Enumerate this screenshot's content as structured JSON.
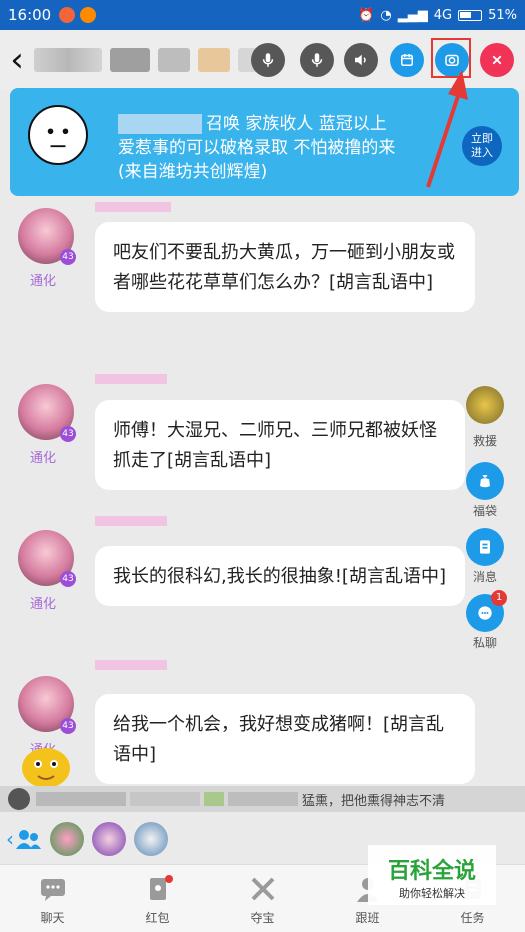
{
  "status_bar": {
    "time": "16:00",
    "network": "4G",
    "battery": "51%"
  },
  "header": {
    "actions": [
      "mic-icon",
      "mic-icon",
      "speaker-icon",
      "calendar-icon",
      "camera-icon",
      "close-icon"
    ]
  },
  "banner": {
    "line1": "召唤 家族收人  蓝冠以上",
    "line2": "爱惹事的可以破格录取  不怕被撸的来",
    "line3": "(来自潍坊共创辉煌)",
    "enter_line1": "立即",
    "enter_line2": "进入"
  },
  "messages": [
    {
      "place": "通化",
      "level": "43",
      "text": "吧友们不要乱扔大黄瓜，万一砸到小朋友或者哪些花花草草们怎么办？[胡言乱语中]"
    },
    {
      "place": "通化",
      "level": "43",
      "text": "师傅！大湿兄、二师兄、三师兄都被妖怪抓走了[胡言乱语中]"
    },
    {
      "place": "通化",
      "level": "43",
      "text": "我长的很科幻,我长的很抽象![胡言乱语中]"
    },
    {
      "place": "通化",
      "level": "43",
      "text": "给我一个机会，我好想变成猪啊！[胡言乱语中]"
    }
  ],
  "side_actions": [
    {
      "label": "救援",
      "icon": "avatar-icon"
    },
    {
      "label": "福袋",
      "icon": "lucky-bag-icon"
    },
    {
      "label": "消息",
      "icon": "message-icon"
    },
    {
      "label": "私聊",
      "icon": "private-chat-icon",
      "badge": "1"
    }
  ],
  "notice": {
    "text": "猛熏，把他熏得神志不清"
  },
  "tabs": [
    "聊天",
    "红包",
    "夺宝",
    "跟班",
    "任务"
  ],
  "watermark": {
    "title": "百科全说",
    "subtitle": "助你轻松解决"
  },
  "colors": {
    "status_bar": "#1565c0",
    "banner": "#39b3ec",
    "accent_red": "#e53935",
    "level_badge": "#9c4fd6"
  }
}
